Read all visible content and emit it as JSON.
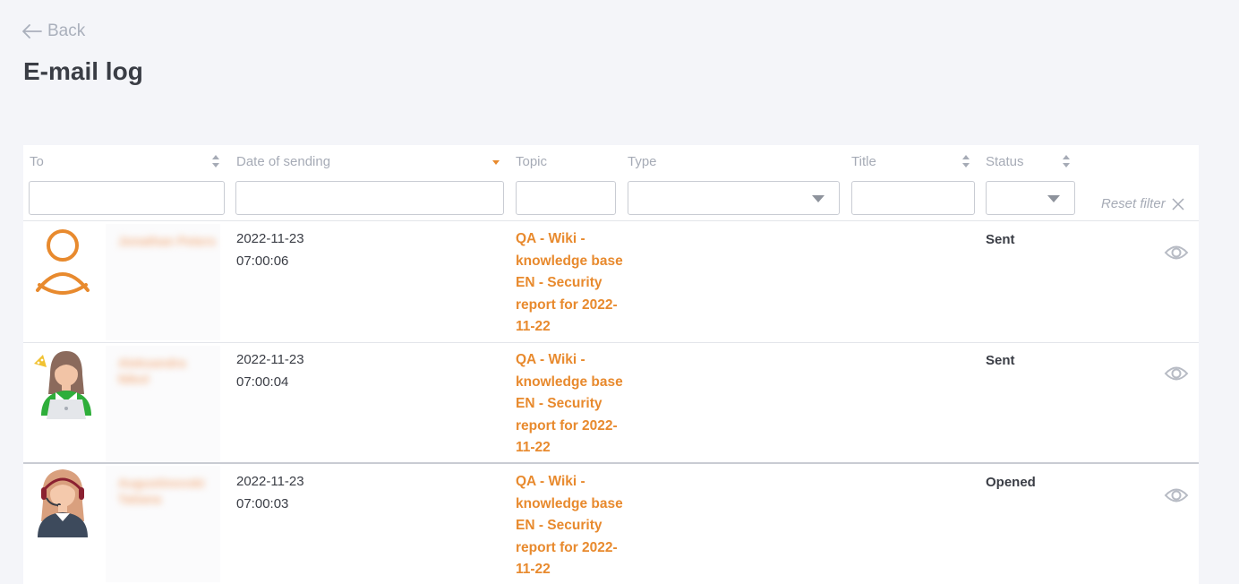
{
  "nav": {
    "back_label": "Back"
  },
  "page": {
    "title": "E-mail log"
  },
  "table": {
    "columns": {
      "to": "To",
      "date": "Date of sending",
      "topic": "Topic",
      "type": "Type",
      "title": "Title",
      "status": "Status"
    },
    "filters": {
      "to_value": "",
      "date_value": "",
      "topic_value": "",
      "type_value": "",
      "title_value": "",
      "status_value": ""
    },
    "reset_filter_label": "Reset filter",
    "rows": [
      {
        "avatar": "user-outline-icon",
        "recipient": "Jonathan Peters",
        "date": "2022-11-23",
        "time": "07:00:06",
        "topic": "QA - Wiki - knowledge base EN - Security report for 2022-11-22",
        "status": "Sent"
      },
      {
        "avatar": "woman-laptop-avatar-icon",
        "recipient": "Aleksandra Nikol",
        "date": "2022-11-23",
        "time": "07:00:04",
        "topic": "QA - Wiki - knowledge base EN - Security report for 2022-11-22",
        "status": "Sent"
      },
      {
        "avatar": "support-agent-avatar-icon",
        "recipient": "Augustinovski Tatiana",
        "date": "2022-11-23",
        "time": "07:00:03",
        "topic": "QA - Wiki - knowledge base EN - Security report for 2022-11-22",
        "status": "Opened"
      }
    ]
  },
  "colors": {
    "accent": "#e88a2e",
    "text": "#3a3d45",
    "muted": "#a6abb6",
    "background": "#f4f5f9"
  }
}
